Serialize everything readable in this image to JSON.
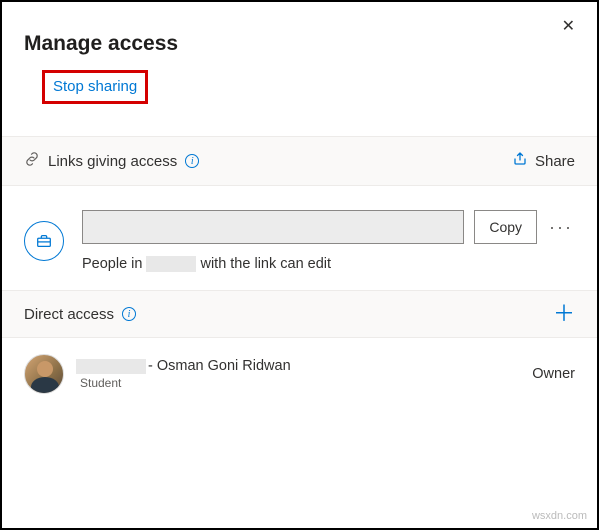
{
  "dialog": {
    "title": "Manage access",
    "stop_sharing": "Stop sharing"
  },
  "links_section": {
    "label": "Links giving access",
    "share_label": "Share",
    "copy_label": "Copy",
    "desc_prefix": "People in",
    "desc_suffix": "with the link can edit"
  },
  "direct_section": {
    "label": "Direct access"
  },
  "user": {
    "name_suffix": "- Osman Goni Ridwan",
    "role": "Student",
    "permission": "Owner"
  },
  "watermark": "wsxdn.com"
}
